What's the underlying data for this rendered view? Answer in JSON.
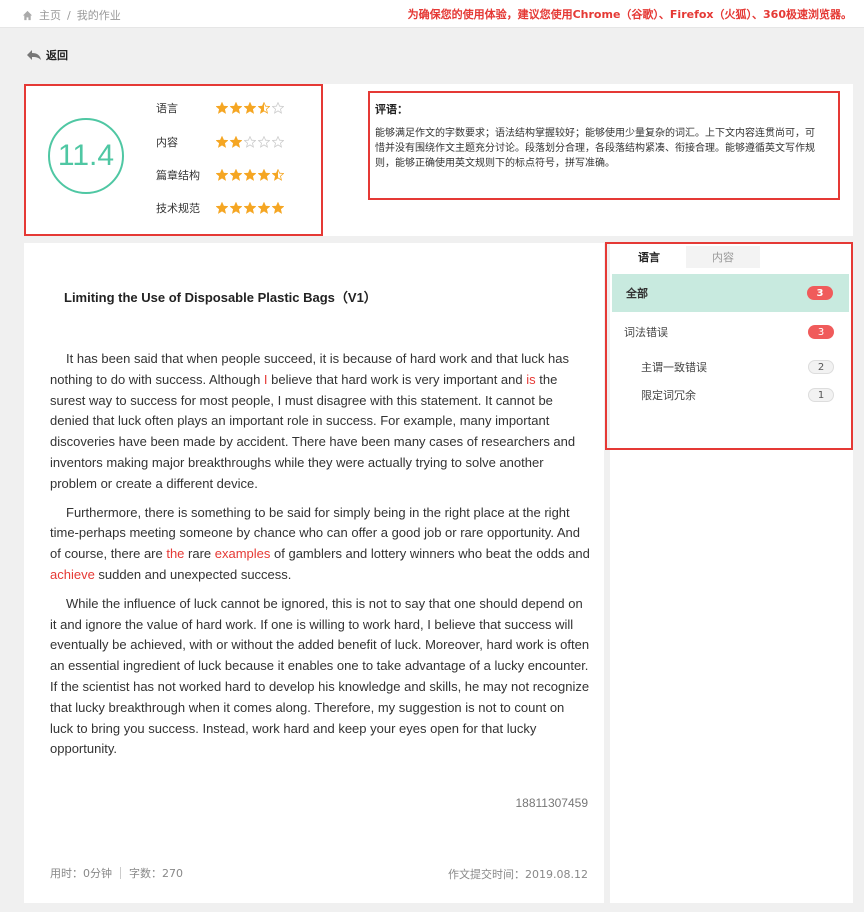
{
  "breadcrumb": {
    "home": "主页",
    "sep": "/",
    "current": "我的作业"
  },
  "notice": "为确保您的使用体验，建议您使用Chrome（谷歌）、Firefox（火狐）、360极速浏览器。",
  "back_label": "返回",
  "score": "11.4",
  "ratings": [
    {
      "label": "语言",
      "stars": 3.5
    },
    {
      "label": "内容",
      "stars": 2
    },
    {
      "label": "篇章结构",
      "stars": 4.5
    },
    {
      "label": "技术规范",
      "stars": 5
    }
  ],
  "comment": {
    "title": "评语：",
    "text": "能够满足作文的字数要求；语法结构掌握较好；能够使用少量复杂的词汇。上下文内容连贯尚可，可惜并没有围绕作文主题充分讨论。段落划分合理，各段落结构紧凑、衔接合理。能够遵循英文写作规则，能够正确使用英文规则下的标点符号，拼写准确。"
  },
  "essay": {
    "title": "Limiting the Use of Disposable Plastic Bags（V1）",
    "p1": [
      "It has been said that when people succeed, it is because of hard work and that luck has nothing to do with success.  Although ",
      "I",
      " believe that hard work is very important and ",
      "is",
      " the surest way to success for most people, I must disagree with this statement.  It cannot be denied that luck often plays an important role in success.  For example, many important discoveries have been made by accident.  There have been many cases of researchers and inventors making major breakthroughs while they were actually trying to solve another problem or create a different device."
    ],
    "p2": [
      "Furthermore, there is something to be said for simply being in the right place at the right time-perhaps meeting someone by chance who can offer a good job or rare opportunity.  And of course, there are ",
      "the",
      " rare ",
      "examples",
      " of gamblers and lottery winners who beat the odds and ",
      "achieve",
      " sudden and unexpected success."
    ],
    "p3": "While the influence of luck cannot be ignored, this is not to say that one should depend on it and ignore the value of hard work.  If one is willing to work hard, I believe that success will eventually be achieved, with or without the added benefit of luck.  Moreover, hard work is often an essential ingredient of luck because it enables one to take advantage of a lucky encounter.  If the scientist has not worked hard to develop his knowledge and skills, he may  not recognize that lucky breakthrough when it comes along.  Therefore, my suggestion is not to count on luck to bring you success.  Instead, work hard and keep your eyes open for that lucky opportunity.",
    "phone": "18811307459",
    "time_used": "用时：0分钟",
    "word_count": "字数：270",
    "submitted": "作文提交时间：2019.08.12"
  },
  "side": {
    "tabs": [
      "语言",
      "内容"
    ],
    "all": {
      "label": "全部",
      "count": "3"
    },
    "category": {
      "label": "词法错误",
      "count": "3"
    },
    "items": [
      {
        "label": "主谓一致错误",
        "count": "2"
      },
      {
        "label": "限定词冗余",
        "count": "1"
      }
    ]
  },
  "colors": {
    "accent": "#4fc7a3",
    "error": "#e53935",
    "star": "#f5a623"
  }
}
